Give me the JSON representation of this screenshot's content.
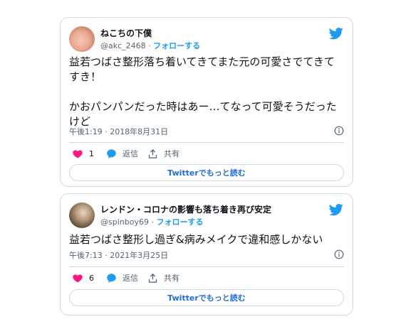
{
  "tweets": [
    {
      "name": "ねこちの下僕",
      "handle": "@akc_2468",
      "separator": " · ",
      "follow_label": "フォローする",
      "text": "益若つばさ整形落ち着いてきてまた元の可愛さでてきてすき！\n\nかおパンパンだった時はあー…てなって可愛そうだったけど",
      "timestamp": "午後1:19 · 2018年8月31日",
      "like_count": "1",
      "reply_label": "返信",
      "share_label": "共有",
      "read_more_label": "Twitterでもっと読む"
    },
    {
      "name": "レンドン・コロナの影響も落ち着き再び安定",
      "handle": "@spinboy69",
      "separator": " · ",
      "follow_label": "フォローする",
      "text": "益若つばさ整形し過ぎ&病みメイクで違和感しかない",
      "timestamp": "午後7:13 · 2021年3月25日",
      "like_count": "6",
      "reply_label": "返信",
      "share_label": "共有",
      "read_more_label": "Twitterでもっと読む"
    }
  ],
  "colors": {
    "twitter_blue": "#1d9bf0",
    "like_pink": "#f91880",
    "text_primary": "#0f1419",
    "text_secondary": "#536471",
    "border": "#cfd9de"
  },
  "icons": [
    "twitter-bird-icon",
    "info-icon",
    "heart-icon",
    "reply-bubble-icon",
    "share-icon"
  ]
}
